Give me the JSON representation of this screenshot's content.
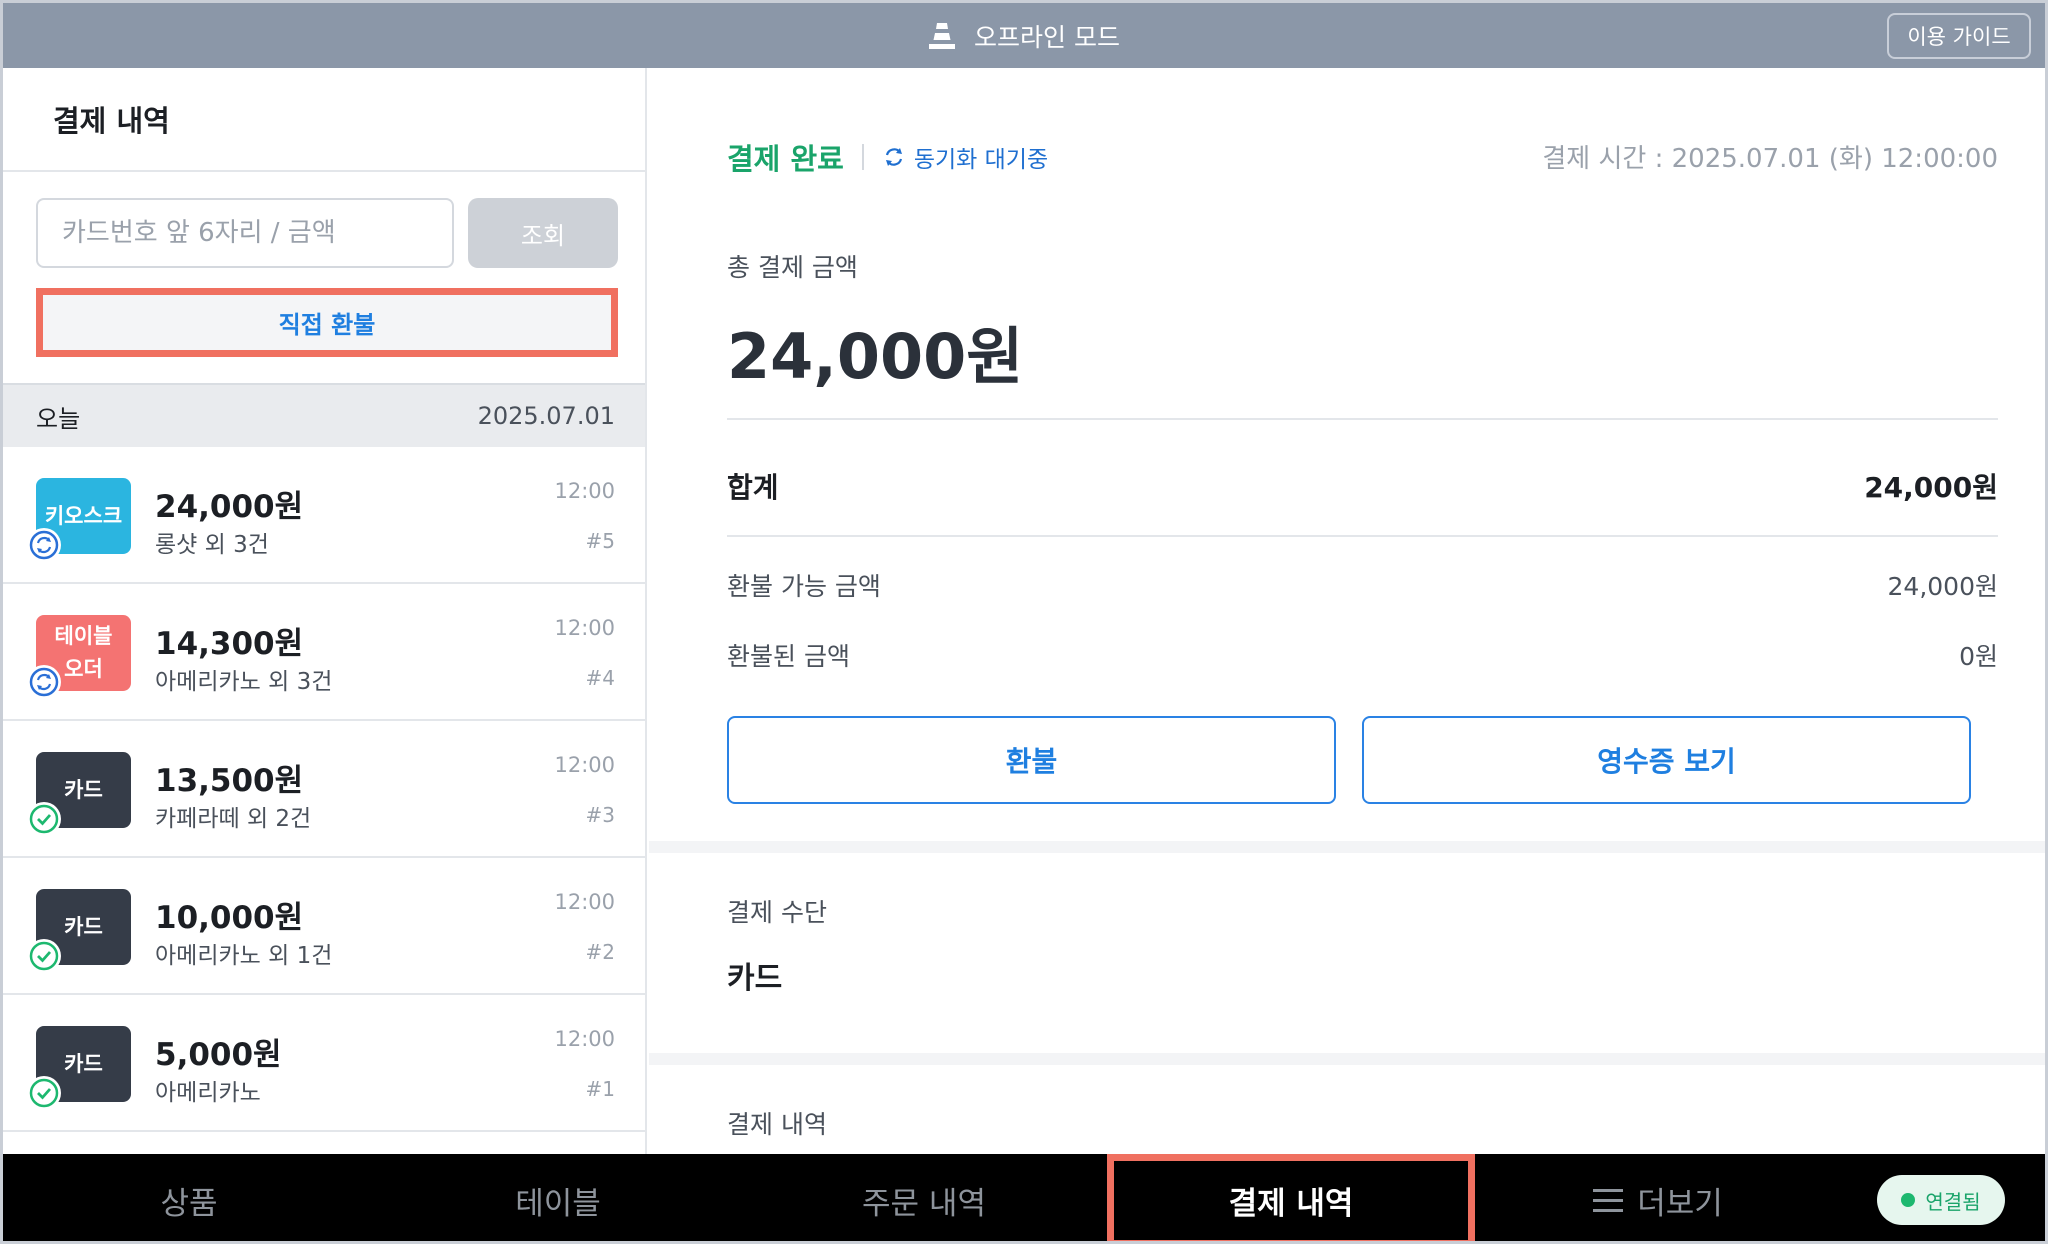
{
  "topbar": {
    "mode_label": "오프라인 모드",
    "guide_button": "이용 가이드"
  },
  "left_panel": {
    "title": "결제 내역",
    "search_placeholder": "카드번호 앞 6자리 / 금액",
    "search_button": "조회",
    "direct_refund_button": "직접 환불",
    "date_group": {
      "label": "오늘",
      "date": "2025.07.01"
    },
    "payments": [
      {
        "channel": "키오스크",
        "amount": "24,000원",
        "summary": "롱샷 외 3건",
        "time": "12:00",
        "number": "#5",
        "sync_status": "pending"
      },
      {
        "channel": "테이블\n오더",
        "amount": "14,300원",
        "summary": "아메리카노 외 3건",
        "time": "12:00",
        "number": "#4",
        "sync_status": "pending"
      },
      {
        "channel": "카드",
        "amount": "13,500원",
        "summary": "카페라떼 외 2건",
        "time": "12:00",
        "number": "#3",
        "sync_status": "done"
      },
      {
        "channel": "카드",
        "amount": "10,000원",
        "summary": "아메리카노 외 1건",
        "time": "12:00",
        "number": "#2",
        "sync_status": "done"
      },
      {
        "channel": "카드",
        "amount": "5,000원",
        "summary": "아메리카노",
        "time": "12:00",
        "number": "#1",
        "sync_status": "done"
      }
    ]
  },
  "detail": {
    "status": "결제 완료",
    "sync_status": "동기화 대기중",
    "pay_time": "결제 시간 : 2025.07.01 (화) 12:00:00",
    "total_label": "총 결제 금액",
    "total_amount": "24,000원",
    "sum_label": "합계",
    "sum_value": "24,000원",
    "refundable_label": "환불 가능 금액",
    "refundable_value": "24,000원",
    "refunded_label": "환불된 금액",
    "refunded_value": "0원",
    "refund_button": "환불",
    "receipt_button": "영수증 보기",
    "method_label": "결제 수단",
    "method_value": "카드",
    "history_label": "결제 내역"
  },
  "bottom_nav": {
    "items": [
      "상품",
      "테이블",
      "주문 내역",
      "결제 내역",
      "더보기"
    ],
    "active": "결제 내역",
    "connection_status": "연결됨"
  },
  "colors": {
    "topbar": "#8b97a8",
    "accent_blue": "#1f7fe0",
    "success_green": "#1aa46a",
    "highlight_red": "#f07060",
    "kiosk_badge": "#2bb5e0",
    "table_badge": "#f47372",
    "card_badge": "#353c48"
  }
}
